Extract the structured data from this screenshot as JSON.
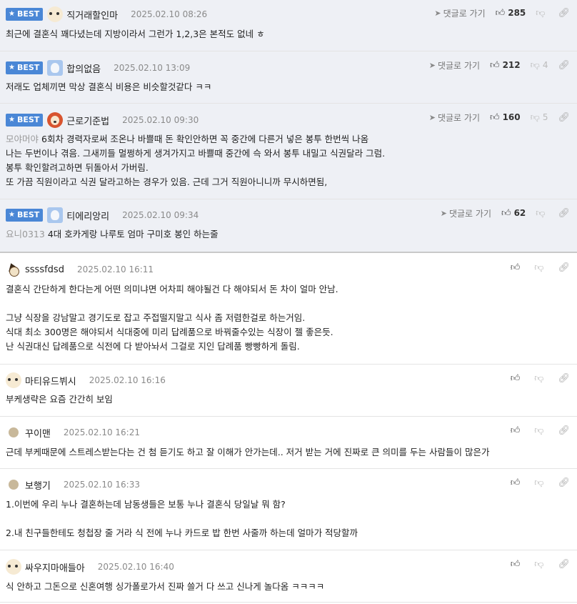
{
  "labels": {
    "best": "BEST",
    "reply_link": "댓글로 가기"
  },
  "best_comments": [
    {
      "nick": "직거래할인마",
      "date": "2025.02.10 08:26",
      "up": "285",
      "down": "",
      "avatar": "dog",
      "mention": "",
      "lines": [
        "최근에 결혼식 꽤다녔는데 지방이라서 그런가 1,2,3은 본적도 없네 ㅎ"
      ]
    },
    {
      "nick": "합의없음",
      "date": "2025.02.10 13:09",
      "up": "212",
      "down": "4",
      "avatar": "blue",
      "mention": "",
      "lines": [
        "저래도 업체끼면 막상 결혼식 비용은 비슷할것같다 ㅋㅋ"
      ]
    },
    {
      "nick": "근로기준법",
      "date": "2025.02.10 09:30",
      "up": "160",
      "down": "5",
      "avatar": "red",
      "mention": "모야머야",
      "lines": [
        "6회차 경력자로써 조온나 바쁠때 돈 확인안하면 꼭 중간에 다른거 넣은 봉투 한번씩 나옴",
        "나는 두번이나 겪음. 그새끼들 멀쩡하게 생겨가지고 바쁠때 중간에 슥 와서 봉투 내밀고 식권달라 그럼.",
        "봉투 확인할려고하면 뒤돌아서 가버림.",
        "또 가끔 직원이라고 식권 달라고하는 경우가 있음. 근데 그거 직원아니니까 무시하면됨,"
      ]
    },
    {
      "nick": "티에리앙리",
      "date": "2025.02.10 09:34",
      "up": "62",
      "down": "",
      "avatar": "blue",
      "mention": "요니0313",
      "lines": [
        "4대 호카게랑 나루토 엄마 구미호 봉인 하는줄"
      ]
    }
  ],
  "comments": [
    {
      "nick": "ssssfdsd",
      "date": "2025.02.10 16:11",
      "avatar": "dog2",
      "lines": [
        "결혼식 간단하게 한다는게 어떤 의미냐면 어차피 해야될건 다 해야되서 돈 차이 얼마 안남.",
        "",
        "그냥 식장을 강남말고 경기도로 잡고 주접떨지말고 식사 좀 저렴한걸로 하는거임.",
        "식대 최소 300명은 해야되서 식대중에 미리 답례품으로 바꿔줄수있는 식장이 젤 좋은듯.",
        "난 식권대신 답례품으로 식전에 다 받아놔서 그걸로 지인 답례품 빵빵하게 돌림."
      ]
    },
    {
      "nick": "마티유드뷔시",
      "date": "2025.02.10 16:16",
      "avatar": "dog",
      "lines": [
        "부케생략은 요즘 간간히 보임"
      ]
    },
    {
      "nick": "꾸이맨",
      "date": "2025.02.10 16:21",
      "avatar": "ball",
      "lines": [
        "근데 부케때문에 스트레스받는다는 건 첨 듣기도 하고 잘 이해가 안가는데.. 저거 받는 거에 진짜로 큰 의미를 두는 사람들이 많은가"
      ]
    },
    {
      "nick": "보행기",
      "date": "2025.02.10 16:33",
      "avatar": "ball",
      "lines": [
        "1.이번에 우리 누나 결혼하는데 남동생들은 보통 누나 결혼식 당일날 뭐 함?",
        "",
        "2.내 친구들한테도 청첩장 줄 거라 식 전에 누나 카드로 밥 한번 사줄까 하는데 얼마가 적당할까"
      ]
    },
    {
      "nick": "싸우지마애들아",
      "date": "2025.02.10 16:40",
      "avatar": "dog",
      "lines": [
        "식 안하고 그돈으로 신혼여행 싱가폴로가서 진짜 쓸거 다 쓰고 신나게 놀다옴 ㅋㅋㅋㅋ"
      ]
    }
  ]
}
